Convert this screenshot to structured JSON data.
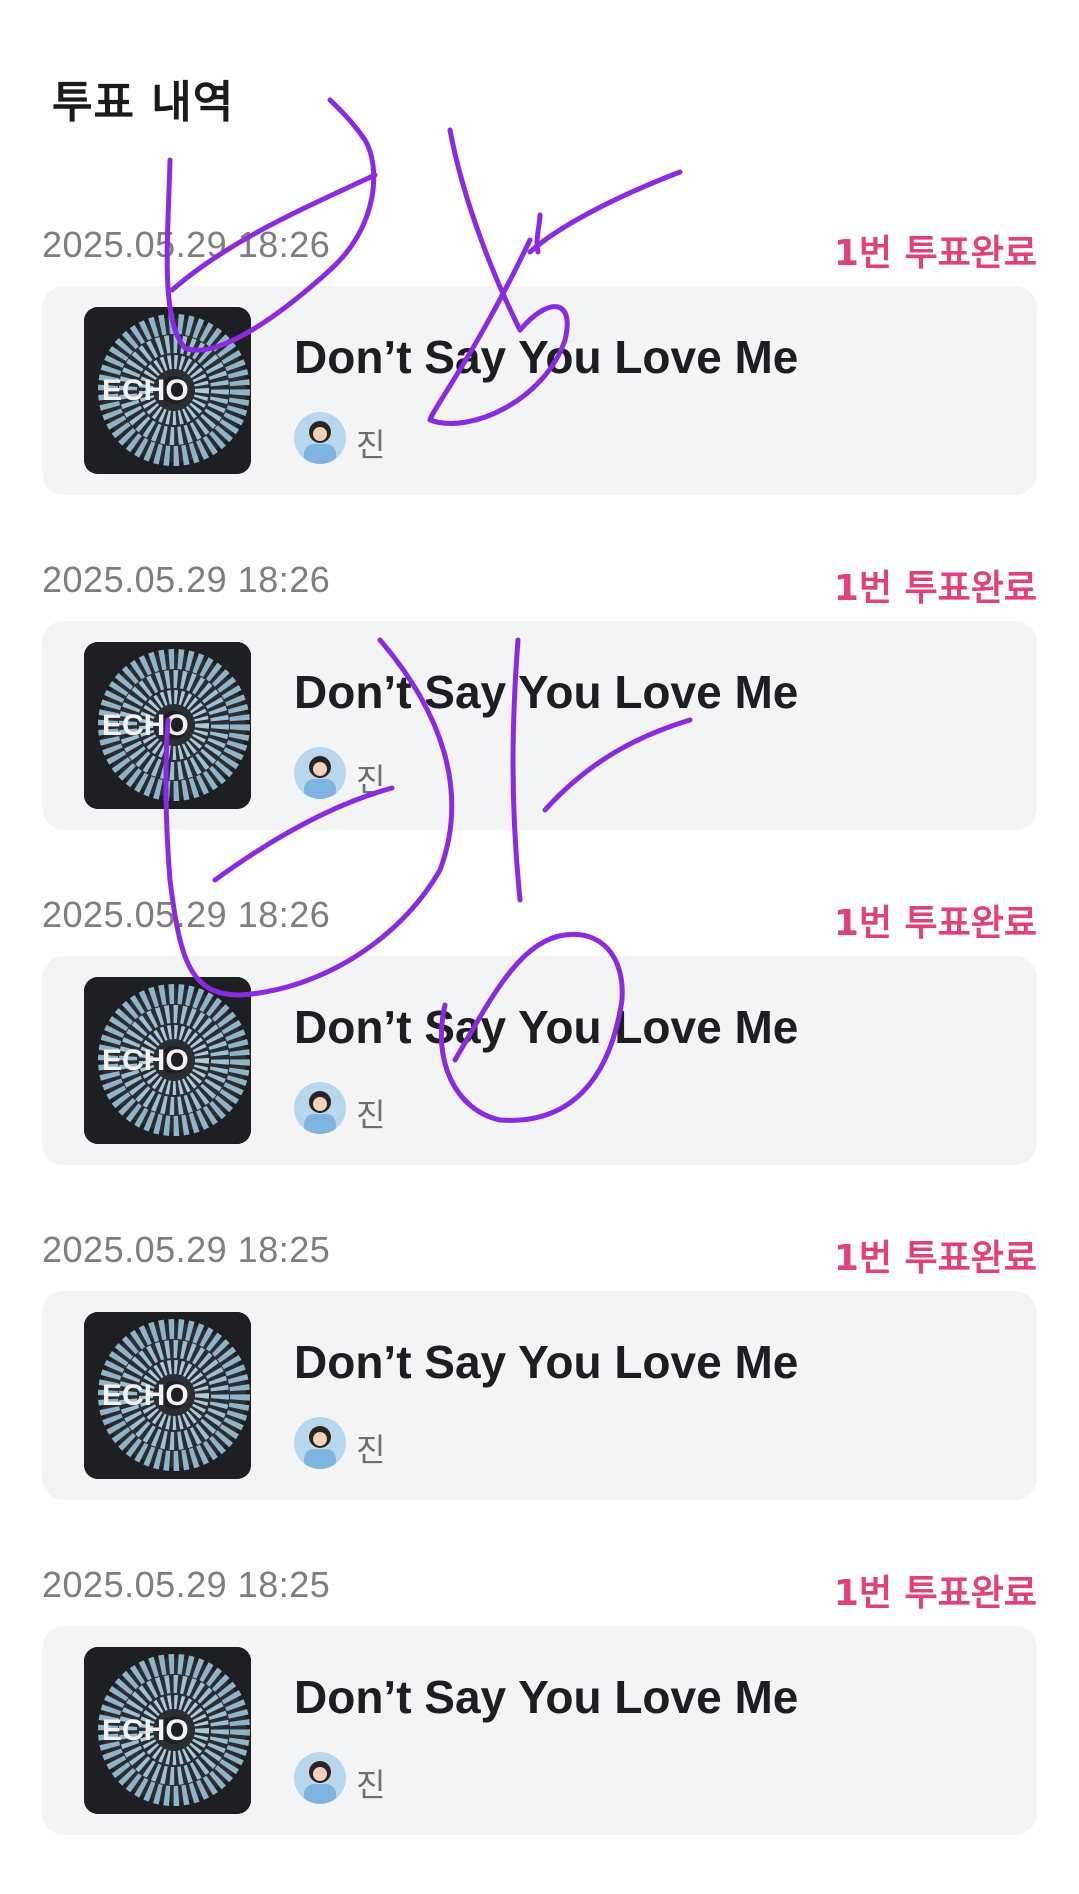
{
  "page": {
    "title": "투표 내역"
  },
  "colors": {
    "accent": "#e0407d",
    "card_background": "#f3f4f6",
    "timestamp": "#7d7d82",
    "scribble": "#8a2be2"
  },
  "entries": [
    {
      "timestamp": "2025.05.29 18:26",
      "status": "1번 투표완료",
      "song_title": "Don’t Say You Love Me",
      "artist": "진",
      "album_art_text": "ECHO"
    },
    {
      "timestamp": "2025.05.29 18:26",
      "status": "1번 투표완료",
      "song_title": "Don’t Say You Love Me",
      "artist": "진",
      "album_art_text": "ECHO"
    },
    {
      "timestamp": "2025.05.29 18:26",
      "status": "1번 투표완료",
      "song_title": "Don’t Say You Love Me",
      "artist": "진",
      "album_art_text": "ECHO"
    },
    {
      "timestamp": "2025.05.29 18:25",
      "status": "1번 투표완료",
      "song_title": "Don’t Say You Love Me",
      "artist": "진",
      "album_art_text": "ECHO"
    },
    {
      "timestamp": "2025.05.29 18:25",
      "status": "1번 투표완료",
      "song_title": "Don’t Say You Love Me",
      "artist": "진",
      "album_art_text": "ECHO"
    }
  ],
  "icons": {
    "album_art": "album-cover-image",
    "avatar": "artist-avatar-image"
  }
}
